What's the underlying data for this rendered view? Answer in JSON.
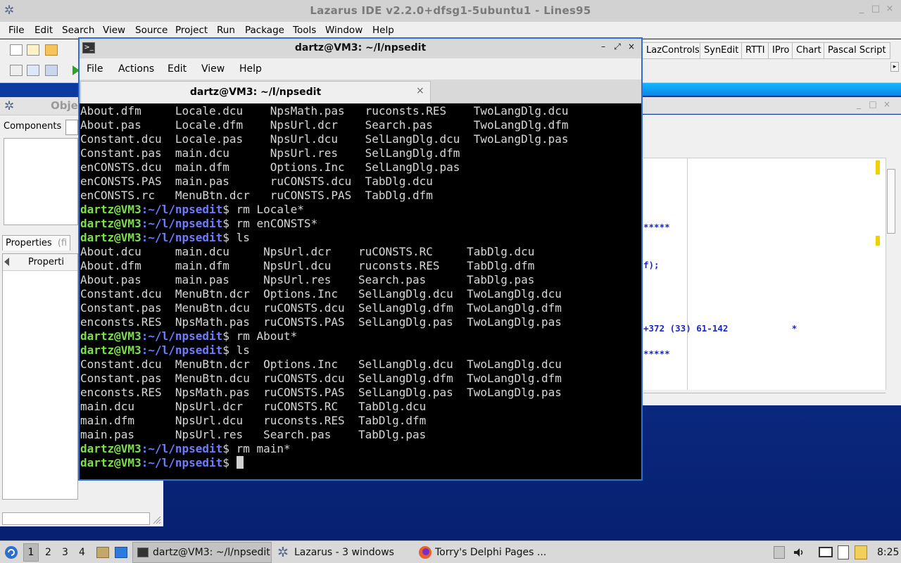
{
  "lazarus": {
    "title": "Lazarus IDE v2.2.0+dfsg1-5ubuntu1 - Lines95",
    "window_controls": [
      "_",
      "□",
      "×"
    ],
    "menu": [
      "File",
      "Edit",
      "Search",
      "View",
      "Source",
      "Project",
      "Run",
      "Package",
      "Tools",
      "Window",
      "Help"
    ],
    "palette_tabs": [
      "LazControls",
      "SynEdit",
      "RTTI",
      "IPro",
      "Chart",
      "Pascal Script"
    ],
    "palette_scroll": "▸"
  },
  "object_inspector": {
    "title": "Obje",
    "components_label": "Components",
    "properties_tab": "Properties",
    "properties_tab_extra": "(fi",
    "properties_header": "Properti"
  },
  "source_editor": {
    "code_lines": [
      "*****",
      "f);",
      "+372 (33) 61-142            *",
      "*****"
    ]
  },
  "terminal": {
    "window_title": "dartz@VM3: ~/l/npsedit",
    "icon_glyph": ">_",
    "window_controls": [
      "–",
      "⤢",
      "×"
    ],
    "menu": [
      "File",
      "Actions",
      "Edit",
      "View",
      "Help"
    ],
    "tab_title": "dartz@VM3: ~/l/npsedit",
    "tab_close": "×",
    "prompt_user": "dartz@VM3",
    "prompt_path": ":~/l/npsedit",
    "lines": [
      {
        "type": "out",
        "text": "About.dfm     Locale.dcu    NpsMath.pas   ruconsts.RES    TwoLangDlg.dcu"
      },
      {
        "type": "out",
        "text": "About.pas     Locale.dfm    NpsUrl.dcr    Search.pas      TwoLangDlg.dfm"
      },
      {
        "type": "out",
        "text": "Constant.dcu  Locale.pas    NpsUrl.dcu    SelLangDlg.dcu  TwoLangDlg.pas"
      },
      {
        "type": "out",
        "text": "Constant.pas  main.dcu      NpsUrl.res    SelLangDlg.dfm"
      },
      {
        "type": "out",
        "text": "enCONSTS.dcu  main.dfm      Options.Inc   SelLangDlg.pas"
      },
      {
        "type": "out",
        "text": "enCONSTS.PAS  main.pas      ruCONSTS.dcu  TabDlg.dcu"
      },
      {
        "type": "out",
        "text": "enCONSTS.rc   MenuBtn.dcr   ruCONSTS.PAS  TabDlg.dfm"
      },
      {
        "type": "cmd",
        "text": "$ rm Locale*"
      },
      {
        "type": "cmd",
        "text": "$ rm enCONSTS*"
      },
      {
        "type": "cmd",
        "text": "$ ls"
      },
      {
        "type": "out",
        "text": "About.dcu     main.dcu     NpsUrl.dcr    ruCONSTS.RC     TabDlg.dcu"
      },
      {
        "type": "out",
        "text": "About.dfm     main.dfm     NpsUrl.dcu    ruconsts.RES    TabDlg.dfm"
      },
      {
        "type": "out",
        "text": "About.pas     main.pas     NpsUrl.res    Search.pas      TabDlg.pas"
      },
      {
        "type": "out",
        "text": "Constant.dcu  MenuBtn.dcr  Options.Inc   SelLangDlg.dcu  TwoLangDlg.dcu"
      },
      {
        "type": "out",
        "text": "Constant.pas  MenuBtn.dcu  ruCONSTS.dcu  SelLangDlg.dfm  TwoLangDlg.dfm"
      },
      {
        "type": "out",
        "text": "enconsts.RES  NpsMath.pas  ruCONSTS.PAS  SelLangDlg.pas  TwoLangDlg.pas"
      },
      {
        "type": "cmd",
        "text": "$ rm About*"
      },
      {
        "type": "cmd",
        "text": "$ ls"
      },
      {
        "type": "out",
        "text": "Constant.dcu  MenuBtn.dcr  Options.Inc   SelLangDlg.dcu  TwoLangDlg.dcu"
      },
      {
        "type": "out",
        "text": "Constant.pas  MenuBtn.dcu  ruCONSTS.dcu  SelLangDlg.dfm  TwoLangDlg.dfm"
      },
      {
        "type": "out",
        "text": "enconsts.RES  NpsMath.pas  ruCONSTS.PAS  SelLangDlg.pas  TwoLangDlg.pas"
      },
      {
        "type": "out",
        "text": "main.dcu      NpsUrl.dcr   ruCONSTS.RC   TabDlg.dcu"
      },
      {
        "type": "out",
        "text": "main.dfm      NpsUrl.dcu   ruconsts.RES  TabDlg.dfm"
      },
      {
        "type": "out",
        "text": "main.pas      NpsUrl.res   Search.pas    TabDlg.pas"
      },
      {
        "type": "cmd",
        "text": "$ rm main*"
      },
      {
        "type": "prompt",
        "text": "$ "
      }
    ]
  },
  "taskbar": {
    "workspaces": [
      "1",
      "2",
      "3",
      "4"
    ],
    "tasks": [
      "dartz@VM3: ~/l/npsedit",
      "Lazarus - 3 windows",
      "Torry's Delphi Pages ..."
    ],
    "clock": "8:25"
  },
  "icons": [
    "lazarus-icon",
    "terminal-icon",
    "firefox-icon",
    "file-manager-icon",
    "start-menu-icon",
    "volume-icon",
    "clipboard-icon",
    "network-icon"
  ]
}
